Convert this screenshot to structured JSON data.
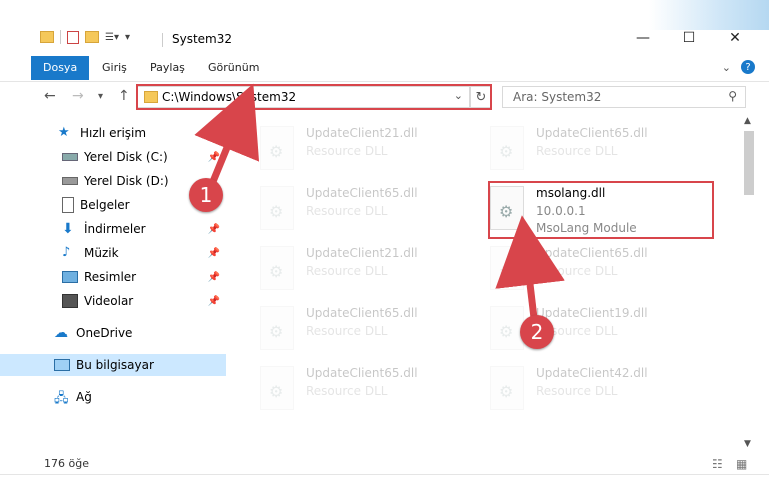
{
  "window": {
    "title": "System32"
  },
  "ribbon": {
    "tabs": [
      {
        "label": "Dosya",
        "active": true
      },
      {
        "label": "Giriş"
      },
      {
        "label": "Paylaş"
      },
      {
        "label": "Görünüm"
      }
    ]
  },
  "nav": {
    "address": "C:\\Windows\\System32",
    "search_placeholder": "Ara: System32"
  },
  "sidebar": {
    "items": [
      {
        "label": "Hızlı erişim"
      },
      {
        "label": "Yerel Disk (C:)"
      },
      {
        "label": "Yerel Disk (D:)"
      },
      {
        "label": "Belgeler"
      },
      {
        "label": "İndirmeler"
      },
      {
        "label": "Müzik"
      },
      {
        "label": "Resimler"
      },
      {
        "label": "Videolar"
      },
      {
        "label": "OneDrive"
      },
      {
        "label": "Bu bilgisayar"
      },
      {
        "label": "Ağ"
      }
    ]
  },
  "files": {
    "left": [
      {
        "name": "UpdateClient21.dll",
        "type": "Resource DLL"
      },
      {
        "name": "UpdateClient65.dll",
        "type": "Resource DLL"
      },
      {
        "name": "UpdateClient21.dll",
        "type": "Resource DLL"
      },
      {
        "name": "UpdateClient65.dll",
        "type": "Resource DLL"
      },
      {
        "name": "UpdateClient65.dll",
        "type": "Resource DLL"
      }
    ],
    "right": [
      {
        "name": "UpdateClient65.dll",
        "type": "Resource DLL"
      },
      {
        "name": "msolang.dll",
        "version": "10.0.0.1",
        "type": "MsoLang Module"
      },
      {
        "name": "UpdateClient65.dll",
        "type": "Resource DLL"
      },
      {
        "name": "UpdateClient19.dll",
        "type": "Resource DLL"
      },
      {
        "name": "UpdateClient42.dll",
        "type": "Resource DLL"
      }
    ]
  },
  "status": {
    "item_count": "176 öğe"
  },
  "annotations": {
    "step1": "1",
    "step2": "2"
  },
  "colors": {
    "accent": "#1979ca",
    "highlight": "#d8454b",
    "selected_bg": "#cce8ff"
  }
}
